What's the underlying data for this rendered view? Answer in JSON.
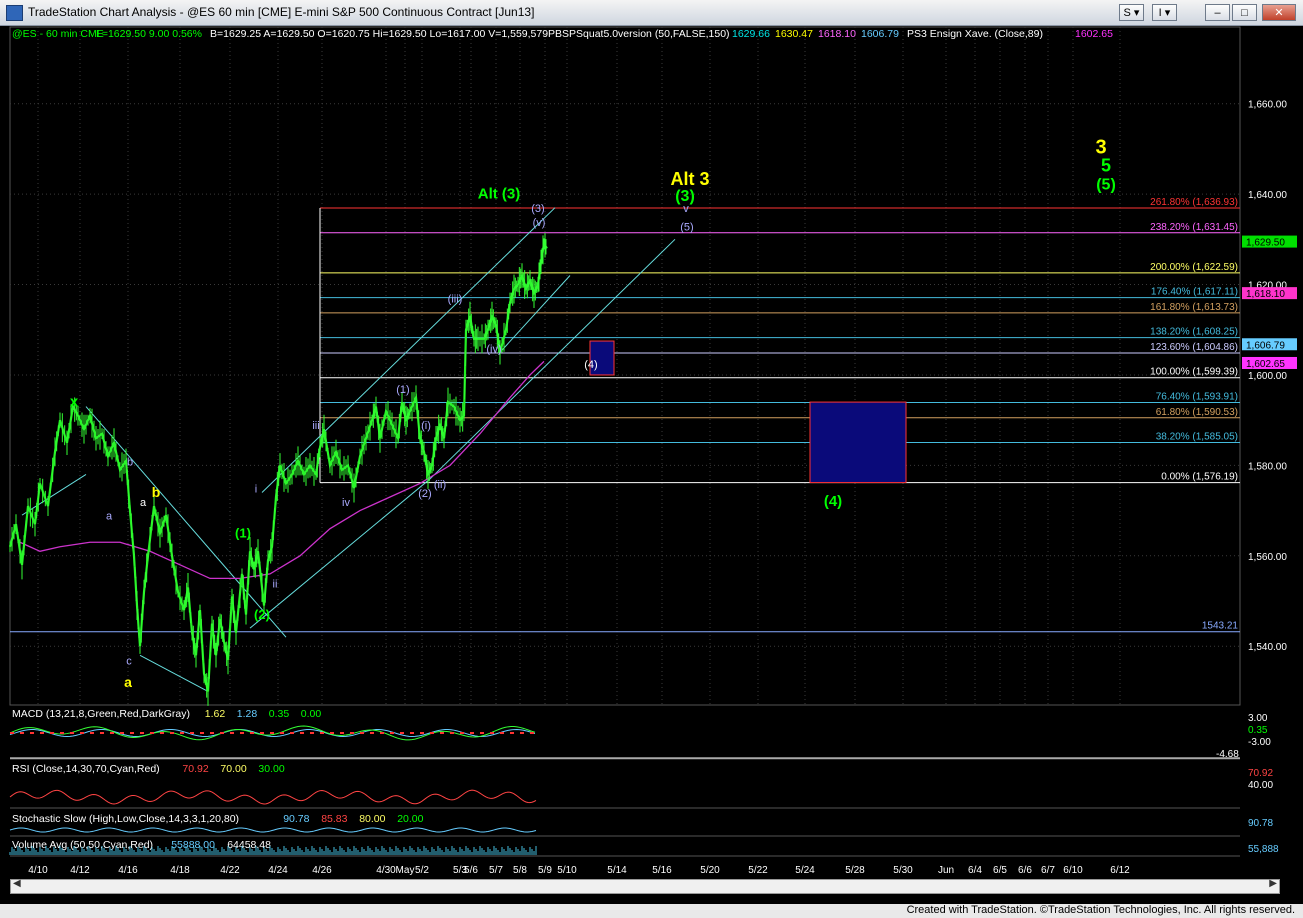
{
  "window": {
    "title": "TradeStation Chart Analysis - @ES 60 min [CME] E-mini S&P 500 Continuous Contract [Jun13]",
    "buttons": [
      "S",
      "I"
    ],
    "footer": "Created with TradeStation. ©TradeStation Technologies, Inc. All rights reserved."
  },
  "header": {
    "items": [
      {
        "text": "@ES - 60 min  CME",
        "color": "#00ff00"
      },
      {
        "text": "L=1629.50  9.00  0.56%",
        "color": "#00ff00"
      },
      {
        "text": "B=1629.25  A=1629.50  O=1620.75  Hi=1629.50  Lo=1617.00  V=1,559,579",
        "color": "#ffffff"
      },
      {
        "text": "PBSPSquat5.0version (50,FALSE,150)",
        "color": "#ffffff"
      },
      {
        "text": "1629.66",
        "color": "#00e6e6"
      },
      {
        "text": "1630.47",
        "color": "#ffff00"
      },
      {
        "text": "1618.10",
        "color": "#ff66ff"
      },
      {
        "text": "1606.79",
        "color": "#66ccff"
      },
      {
        "text": "PS3 Ensign Xave. (Close,89)",
        "color": "#ffffff"
      },
      {
        "text": "1602.65",
        "color": "#ff33ff"
      }
    ]
  },
  "chart_data": {
    "type": "line",
    "symbol": "@ES",
    "interval": "60 min",
    "ylim": [
      1527,
      1669
    ],
    "yticks": [
      1540,
      1560,
      1580,
      1600,
      1620,
      1640,
      1660
    ],
    "ytick_labels": [
      "1,540.00",
      "1,560.00",
      "1,580.00",
      "1,600.00",
      "1,620.00",
      "1,640.00",
      "1,660.00"
    ],
    "xtick_labels": [
      "4/10",
      "4/12",
      "4/16",
      "4/18",
      "4/22",
      "4/24",
      "4/26",
      "4/30",
      "May",
      "5/2",
      "5/3",
      "5/6",
      "5/7",
      "5/8",
      "5/9",
      "5/10",
      "5/14",
      "5/16",
      "5/20",
      "5/22",
      "5/24",
      "5/28",
      "5/30",
      "Jun",
      "6/4",
      "6/5",
      "6/6",
      "6/7",
      "6/10",
      "6/12"
    ],
    "price_path": [
      [
        0,
        1562
      ],
      [
        6,
        1567
      ],
      [
        12,
        1558
      ],
      [
        18,
        1571
      ],
      [
        25,
        1567
      ],
      [
        30,
        1576
      ],
      [
        38,
        1571
      ],
      [
        45,
        1583
      ],
      [
        50,
        1590
      ],
      [
        57,
        1585
      ],
      [
        63,
        1593
      ],
      [
        68,
        1591
      ],
      [
        74,
        1588
      ],
      [
        80,
        1591
      ],
      [
        86,
        1586
      ],
      [
        92,
        1587
      ],
      [
        98,
        1582
      ],
      [
        104,
        1585
      ],
      [
        110,
        1579
      ],
      [
        116,
        1581
      ],
      [
        120,
        1570
      ],
      [
        124,
        1560
      ],
      [
        127,
        1549
      ],
      [
        130,
        1540
      ],
      [
        134,
        1552
      ],
      [
        138,
        1560
      ],
      [
        144,
        1571
      ],
      [
        150,
        1565
      ],
      [
        156,
        1569
      ],
      [
        162,
        1560
      ],
      [
        168,
        1552
      ],
      [
        174,
        1548
      ],
      [
        178,
        1553
      ],
      [
        182,
        1543
      ],
      [
        186,
        1538
      ],
      [
        190,
        1548
      ],
      [
        194,
        1534
      ],
      [
        198,
        1530
      ],
      [
        202,
        1545
      ],
      [
        206,
        1538
      ],
      [
        210,
        1546
      ],
      [
        214,
        1541
      ],
      [
        218,
        1537
      ],
      [
        222,
        1551
      ],
      [
        226,
        1543
      ],
      [
        232,
        1556
      ],
      [
        236,
        1547
      ],
      [
        240,
        1561
      ],
      [
        244,
        1557
      ],
      [
        248,
        1561
      ],
      [
        254,
        1549
      ],
      [
        258,
        1559
      ],
      [
        262,
        1562
      ],
      [
        266,
        1573
      ],
      [
        270,
        1580
      ],
      [
        276,
        1576
      ],
      [
        282,
        1578
      ],
      [
        288,
        1581
      ],
      [
        294,
        1578
      ],
      [
        300,
        1580
      ],
      [
        306,
        1578
      ],
      [
        310,
        1584
      ],
      [
        314,
        1588
      ],
      [
        320,
        1580
      ],
      [
        326,
        1583
      ],
      [
        332,
        1579
      ],
      [
        338,
        1580
      ],
      [
        344,
        1575
      ],
      [
        350,
        1582
      ],
      [
        356,
        1586
      ],
      [
        362,
        1590
      ],
      [
        366,
        1593
      ],
      [
        370,
        1586
      ],
      [
        376,
        1592
      ],
      [
        382,
        1589
      ],
      [
        388,
        1586
      ],
      [
        392,
        1594
      ],
      [
        396,
        1590
      ],
      [
        400,
        1592
      ],
      [
        406,
        1595
      ],
      [
        410,
        1586
      ],
      [
        414,
        1583
      ],
      [
        418,
        1578
      ],
      [
        422,
        1580
      ],
      [
        426,
        1586
      ],
      [
        430,
        1589
      ],
      [
        434,
        1586
      ],
      [
        438,
        1594
      ],
      [
        444,
        1593
      ],
      [
        450,
        1590
      ],
      [
        454,
        1591
      ],
      [
        456,
        1610
      ],
      [
        460,
        1613
      ],
      [
        464,
        1608
      ],
      [
        468,
        1608
      ],
      [
        474,
        1608
      ],
      [
        478,
        1610
      ],
      [
        482,
        1613
      ],
      [
        486,
        1611
      ],
      [
        490,
        1605
      ],
      [
        496,
        1610
      ],
      [
        500,
        1616
      ],
      [
        504,
        1619
      ],
      [
        508,
        1620
      ],
      [
        512,
        1622
      ],
      [
        516,
        1619
      ],
      [
        520,
        1621
      ],
      [
        524,
        1618
      ],
      [
        528,
        1620
      ],
      [
        531,
        1625
      ],
      [
        534,
        1629
      ],
      [
        537,
        1628
      ]
    ],
    "ma89_path": [
      [
        10,
        1563
      ],
      [
        30,
        1561
      ],
      [
        50,
        1562
      ],
      [
        80,
        1563
      ],
      [
        110,
        1563
      ],
      [
        140,
        1561
      ],
      [
        170,
        1558
      ],
      [
        200,
        1555
      ],
      [
        230,
        1555
      ],
      [
        260,
        1556
      ],
      [
        290,
        1560
      ],
      [
        320,
        1566
      ],
      [
        350,
        1570
      ],
      [
        380,
        1573
      ],
      [
        410,
        1576
      ],
      [
        440,
        1580
      ],
      [
        470,
        1587
      ],
      [
        500,
        1595
      ],
      [
        520,
        1600
      ],
      [
        534,
        1603
      ]
    ],
    "price_levels": [
      {
        "value": 1636.93,
        "label": "261.80% (1,636.93)",
        "color": "#ff3333"
      },
      {
        "value": 1631.45,
        "label": "238.20% (1,631.45)",
        "color": "#ff66ff"
      },
      {
        "value": 1622.59,
        "label": "200.00% (1,622.59)",
        "color": "#ffff66"
      },
      {
        "value": 1617.11,
        "label": "176.40% (1,617.11)",
        "color": "#44bbdd"
      },
      {
        "value": 1613.73,
        "label": "161.80% (1,613.73)",
        "color": "#d2a060"
      },
      {
        "value": 1608.25,
        "label": "138.20% (1,608.25)",
        "color": "#44bbdd"
      },
      {
        "value": 1604.86,
        "label": "123.60% (1,604.86)",
        "color": "#ccccff"
      },
      {
        "value": 1599.39,
        "label": "100.00% (1,599.39)",
        "color": "#ffffff"
      },
      {
        "value": 1593.91,
        "label": "76.40% (1,593.91)",
        "color": "#44bbdd"
      },
      {
        "value": 1590.53,
        "label": "61.80% (1,590.53)",
        "color": "#d2a060"
      },
      {
        "value": 1585.05,
        "label": "38.20% (1,585.05)",
        "color": "#44bbdd"
      },
      {
        "value": 1576.19,
        "label": "0.00% (1,576.19)",
        "color": "#ffffff"
      }
    ],
    "hline_1543": {
      "value": 1543.21,
      "label": "1543.21",
      "color": "#88aaff"
    },
    "price_tags": [
      {
        "value": 1629.5,
        "label": "1,629.50",
        "bg": "#00e000",
        "fg": "#000000"
      },
      {
        "value": 1618.1,
        "label": "1,618.10",
        "bg": "#ff33cc",
        "fg": "#000000"
      },
      {
        "value": 1606.79,
        "label": "1,606.79",
        "bg": "#66ccff",
        "fg": "#000000"
      },
      {
        "value": 1602.65,
        "label": "1,602.65",
        "bg": "#ff33ff",
        "fg": "#000000"
      }
    ],
    "wave_labels": [
      {
        "text": "x",
        "color": "#00ff00",
        "bold": true,
        "size": 15,
        "x": 74,
        "y": 1593
      },
      {
        "text": "b",
        "color": "#aaaaff",
        "x": 130,
        "y": 1580
      },
      {
        "text": "a",
        "color": "#aaaaff",
        "x": 109,
        "y": 1568
      },
      {
        "text": "a",
        "color": "#ffffff",
        "x": 143,
        "y": 1571
      },
      {
        "text": "b",
        "color": "#ffff00",
        "bold": true,
        "size": 14,
        "x": 156,
        "y": 1573
      },
      {
        "text": "c",
        "color": "#aaaaff",
        "x": 129,
        "y": 1536
      },
      {
        "text": "a",
        "color": "#ffff00",
        "bold": true,
        "size": 14,
        "x": 128,
        "y": 1531
      },
      {
        "text": "(1)",
        "color": "#00ff00",
        "bold": true,
        "size": 13,
        "x": 243,
        "y": 1564
      },
      {
        "text": "(2)",
        "color": "#00ff00",
        "bold": true,
        "size": 13,
        "x": 262,
        "y": 1546
      },
      {
        "text": "i",
        "color": "#aaaaff",
        "x": 256,
        "y": 1574
      },
      {
        "text": "ii",
        "color": "#aaaaff",
        "x": 275,
        "y": 1553
      },
      {
        "text": "iii",
        "color": "#aaaaff",
        "x": 316,
        "y": 1588
      },
      {
        "text": "iv",
        "color": "#aaaaff",
        "x": 346,
        "y": 1571
      },
      {
        "text": "(1)",
        "color": "#aaaaff",
        "x": 403,
        "y": 1596
      },
      {
        "text": "(2)",
        "color": "#aaaaff",
        "x": 425,
        "y": 1573
      },
      {
        "text": "(i)",
        "color": "#aaaaff",
        "x": 426,
        "y": 1588
      },
      {
        "text": "(ii)",
        "color": "#aaaaff",
        "x": 440,
        "y": 1575
      },
      {
        "text": "(iii)",
        "color": "#aaaaff",
        "x": 455,
        "y": 1616
      },
      {
        "text": "(iv)",
        "color": "#aaaaff",
        "x": 494,
        "y": 1605
      },
      {
        "text": "(v)",
        "color": "#aaaaff",
        "x": 539,
        "y": 1633
      },
      {
        "text": "(3)",
        "color": "#aaaaff",
        "x": 538,
        "y": 1636
      },
      {
        "text": "Alt (3)",
        "color": "#00ff00",
        "bold": true,
        "size": 15,
        "x": 499,
        "y": 1639
      },
      {
        "text": "Alt 3",
        "color": "#ffff00",
        "bold": true,
        "size": 18,
        "x": 690,
        "y": 1642
      },
      {
        "text": "(3)",
        "color": "#00ff00",
        "bold": true,
        "size": 16,
        "x": 685,
        "y": 1638.5
      },
      {
        "text": "v",
        "color": "#aaaaff",
        "x": 686,
        "y": 1636
      },
      {
        "text": "(5)",
        "color": "#aaaaff",
        "x": 687,
        "y": 1632
      },
      {
        "text": "(4)",
        "color": "#ffffff",
        "x": 591,
        "y": 1601.5
      },
      {
        "text": "(4)",
        "color": "#00ff00",
        "bold": true,
        "size": 15,
        "x": 833,
        "y": 1571
      },
      {
        "text": "3",
        "color": "#ffff00",
        "bold": true,
        "size": 20,
        "x": 1101,
        "y": 1649
      },
      {
        "text": "5",
        "color": "#00ff00",
        "bold": true,
        "size": 18,
        "x": 1106,
        "y": 1645
      },
      {
        "text": "(5)",
        "color": "#00ff00",
        "bold": true,
        "size": 16,
        "x": 1106,
        "y": 1641
      }
    ],
    "target_boxes": [
      {
        "x0": 580,
        "x1": 604,
        "y0": 1600,
        "y1": 1607.5
      },
      {
        "x0": 800,
        "x1": 896,
        "y0": 1576.2,
        "y1": 1594
      }
    ],
    "indicators": [
      {
        "name": "MACD",
        "label": "MACD (13,21,8,Green,Red,DarkGray)",
        "label_color": "#ffffff",
        "values": [
          {
            "text": "1.62",
            "color": "#ffff66"
          },
          {
            "text": "1.28",
            "color": "#66ccff"
          },
          {
            "text": "0.35",
            "color": "#00ff00"
          },
          {
            "text": "0.00",
            "color": "#00ff00"
          }
        ],
        "axis": [
          "3.00",
          "0.35",
          "-3.00",
          "-4.68"
        ]
      },
      {
        "name": "RSI",
        "label": "RSI (Close,14,30,70,Cyan,Red)",
        "label_color": "#ffffff",
        "values": [
          {
            "text": "70.92",
            "color": "#ff4444"
          },
          {
            "text": "70.00",
            "color": "#ffff66"
          },
          {
            "text": "30.00",
            "color": "#00ff00"
          }
        ],
        "axis": [
          "70.92",
          "40.00"
        ]
      },
      {
        "name": "Stochastic",
        "label": "Stochastic Slow (High,Low,Close,14,3,3,1,20,80)",
        "label_color": "#ffffff",
        "values": [
          {
            "text": "90.78",
            "color": "#66ccff"
          },
          {
            "text": "85.83",
            "color": "#ff4444"
          },
          {
            "text": "80.00",
            "color": "#ffff66"
          },
          {
            "text": "20.00",
            "color": "#00ff00"
          }
        ],
        "axis": [
          "90.78"
        ]
      },
      {
        "name": "Volume",
        "label": "Volume Avg (50,50,Cyan,Red)",
        "label_color": "#ffffff",
        "values": [
          {
            "text": "55888.00",
            "color": "#66ccff"
          },
          {
            "text": "64458.48",
            "color": "#ffffff"
          }
        ],
        "axis": [
          "55,888"
        ]
      }
    ]
  }
}
